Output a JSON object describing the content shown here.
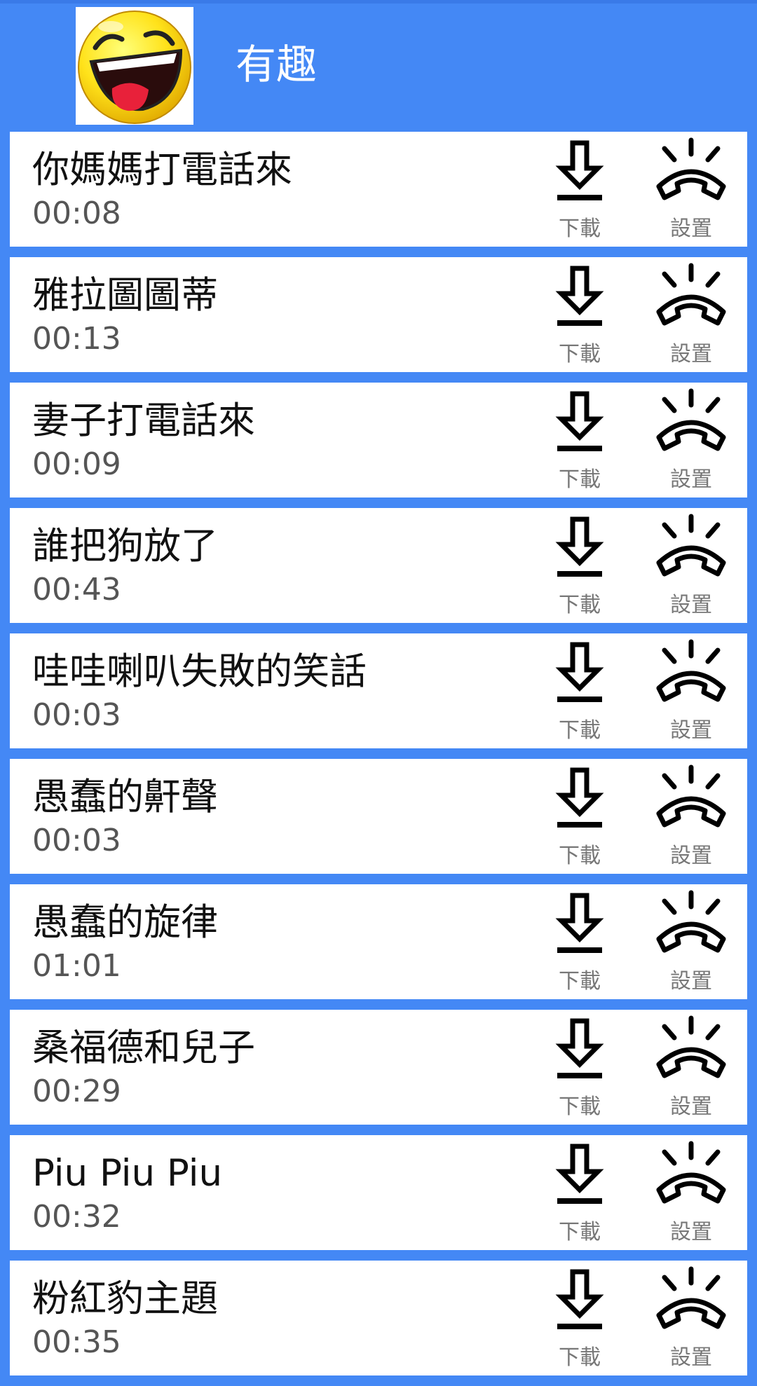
{
  "header": {
    "title": "有趣",
    "logo_icon": "laughing-face-icon",
    "background_color": "#4488f5"
  },
  "actions": {
    "download_label": "下載",
    "download_icon": "download-icon",
    "set_label": "設置",
    "set_icon": "phone-ringing-icon"
  },
  "items": [
    {
      "title": "你媽媽打電話來",
      "duration": "00:08"
    },
    {
      "title": "雅拉圖圖蒂",
      "duration": "00:13"
    },
    {
      "title": "妻子打電話來",
      "duration": "00:09"
    },
    {
      "title": "誰把狗放了",
      "duration": "00:43"
    },
    {
      "title": "哇哇喇叭失敗的笑話",
      "duration": "00:03"
    },
    {
      "title": "愚蠢的鼾聲",
      "duration": "00:03"
    },
    {
      "title": "愚蠢的旋律",
      "duration": "01:01"
    },
    {
      "title": "桑福德和兒子",
      "duration": "00:29"
    },
    {
      "title": "Piu Piu Piu",
      "duration": "00:32"
    },
    {
      "title": "粉紅豹主題",
      "duration": "00:35"
    }
  ]
}
